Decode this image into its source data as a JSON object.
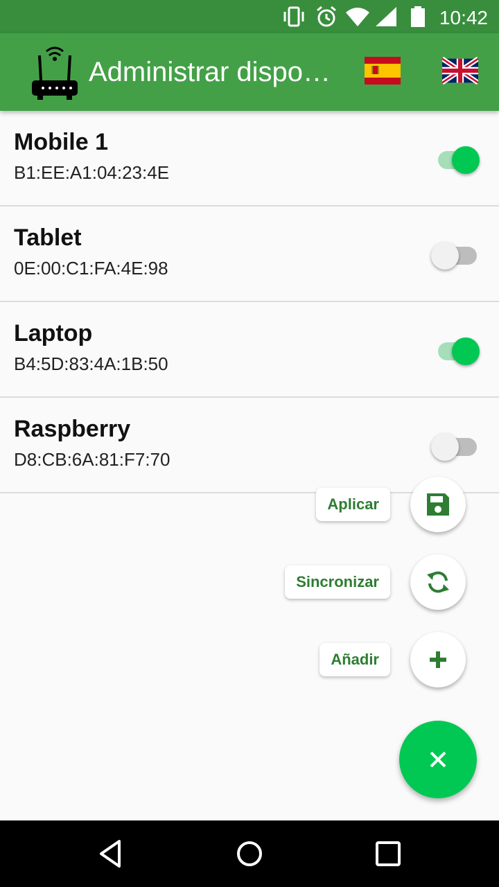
{
  "status_bar": {
    "time": "10:42",
    "icons": [
      "vibrate-icon",
      "alarm-icon",
      "wifi-icon",
      "signal-icon",
      "battery-icon"
    ]
  },
  "app_bar": {
    "logo": "router-icon",
    "title": "Administrar dispositivos",
    "flags": [
      "spain-flag-icon",
      "uk-flag-icon"
    ]
  },
  "devices": [
    {
      "name": "Mobile 1",
      "mac": "B1:EE:A1:04:23:4E",
      "enabled": true
    },
    {
      "name": "Tablet",
      "mac": "0E:00:C1:FA:4E:98",
      "enabled": false
    },
    {
      "name": "Laptop",
      "mac": "B4:5D:83:4A:1B:50",
      "enabled": true
    },
    {
      "name": "Raspberry",
      "mac": "D8:CB:6A:81:F7:70",
      "enabled": false
    }
  ],
  "fab_menu": {
    "apply_label": "Aplicar",
    "apply_icon": "save-icon",
    "sync_label": "Sincronizar",
    "sync_icon": "sync-icon",
    "add_label": "Añadir",
    "add_icon": "plus-icon",
    "main_icon": "close-icon"
  },
  "nav_bar": {
    "icons": [
      "back-icon",
      "home-icon",
      "recents-icon"
    ]
  },
  "colors": {
    "primary": "#43a047",
    "primary_dark": "#388e3c",
    "accent": "#00c853",
    "label_text": "#2e7d32"
  }
}
